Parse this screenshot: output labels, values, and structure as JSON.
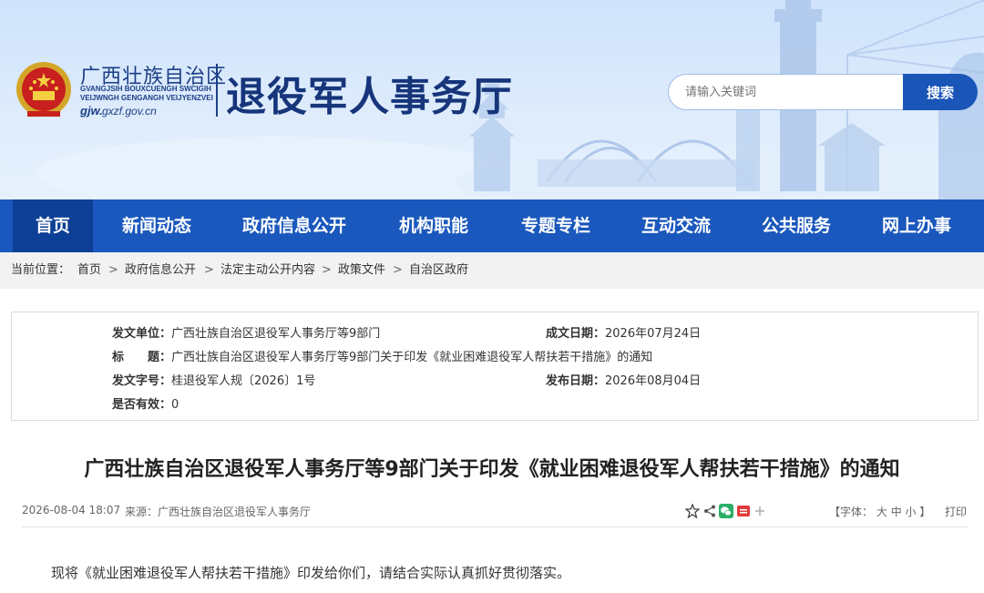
{
  "header": {
    "site_cn": "广西壮族自治区",
    "site_en": "GVANGJSIH BOUXCUENGH SWCIGIH\nVEIJWNGH GENGANGH VEIJYENZVEI",
    "site_url_prefix": "gjw.",
    "site_url": "gxzf.gov.cn",
    "dept_title": "退役军人事务厅",
    "search_placeholder": "请输入关键词",
    "search_button": "搜索"
  },
  "nav": {
    "items": [
      {
        "label": "首页",
        "active": true
      },
      {
        "label": "新闻动态"
      },
      {
        "label": "政府信息公开"
      },
      {
        "label": "机构职能"
      },
      {
        "label": "专题专栏"
      },
      {
        "label": "互动交流"
      },
      {
        "label": "公共服务"
      },
      {
        "label": "网上办事"
      }
    ]
  },
  "breadcrumb": {
    "prefix": "当前位置：",
    "items": [
      "首页",
      "政府信息公开",
      "法定主动公开内容",
      "政策文件",
      "自治区政府"
    ],
    "separator": ">"
  },
  "meta": {
    "issuer_label": "发文单位：",
    "issuer": "广西壮族自治区退役军人事务厅等9部门",
    "date_made_label": "成文日期：",
    "date_made": "2026年07月24日",
    "title_label": "标　　题：",
    "title": "广西壮族自治区退役军人事务厅等9部门关于印发《就业困难退役军人帮扶若干措施》的通知",
    "doc_no_label": "发文字号：",
    "doc_no": "桂退役军人规〔2026〕1号",
    "publish_date_label": "发布日期：",
    "publish_date": "2026年08月04日",
    "valid_label": "是否有效：",
    "valid": "0"
  },
  "article": {
    "title": "广西壮族自治区退役军人事务厅等9部门关于印发《就业困难退役军人帮扶若干措施》的通知",
    "datetime": "2026-08-04 18:07",
    "source": "来源：广西壮族自治区退役军人事务厅",
    "font_size_label": "【字体：",
    "font_size_options": [
      "大",
      "中",
      "小"
    ],
    "font_size_end": "】",
    "print": "打印",
    "body": "现将《就业困难退役军人帮扶若干措施》印发给你们，请结合实际认真抓好贯彻落实。"
  },
  "icons": [
    "national-emblem-icon",
    "share-icon",
    "weibo-icon",
    "wechat-icon",
    "xiaohongshu-icon",
    "plus-icon"
  ],
  "colors": {
    "nav_bg": "#1a58bd",
    "nav_active": "#0c3f95",
    "search_button": "#1a55b8",
    "title_blue": "#16357a"
  }
}
